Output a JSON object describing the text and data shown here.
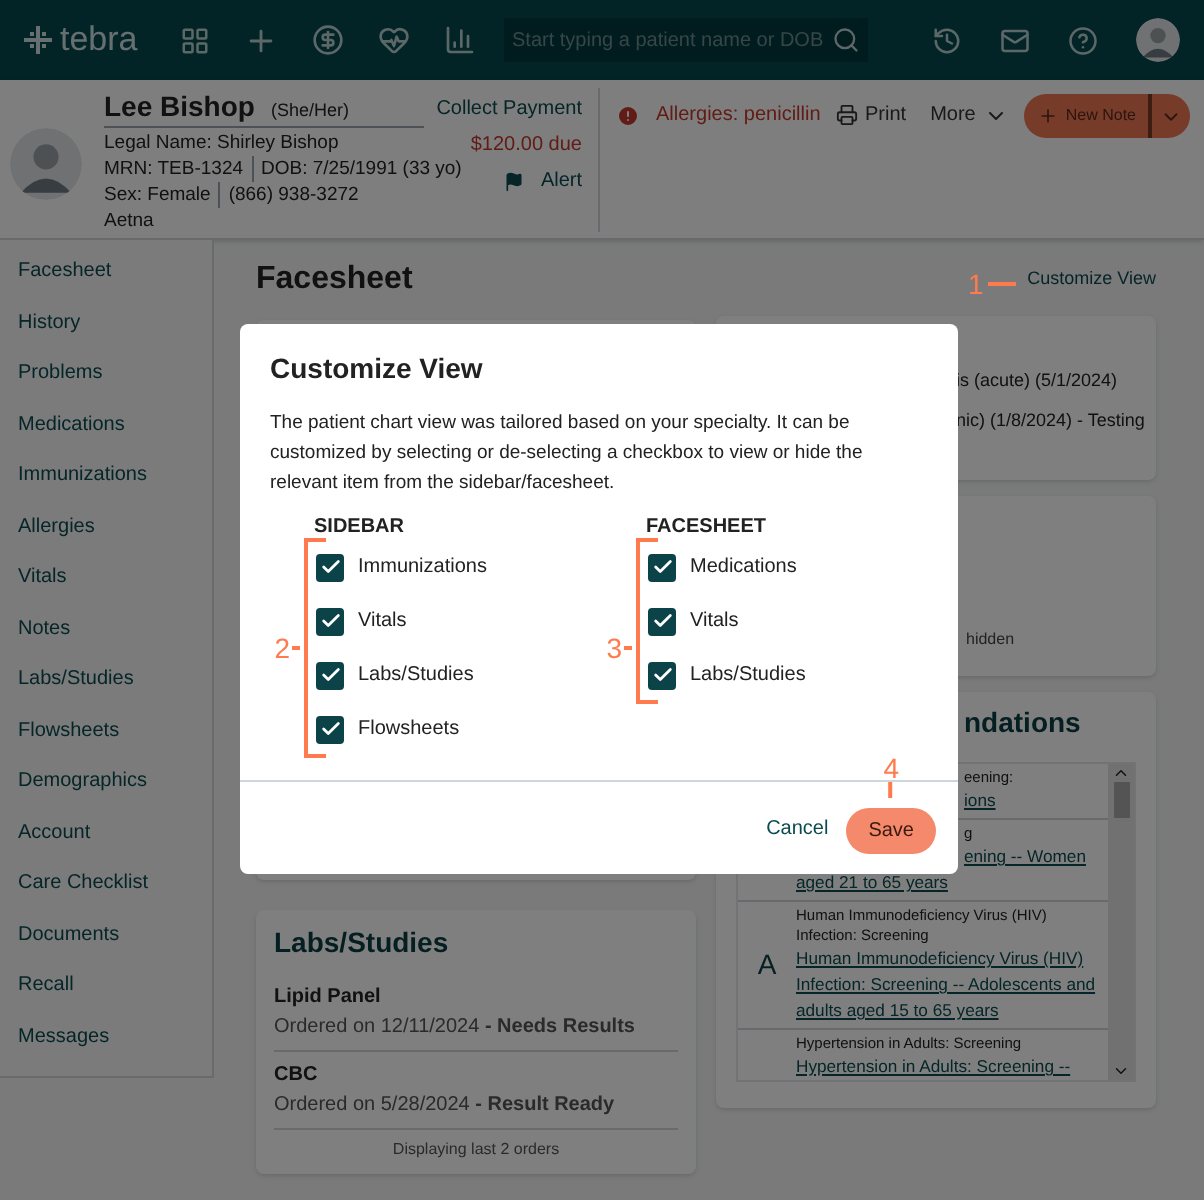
{
  "topbar": {
    "logo": "tebra",
    "search": {
      "placeholder": "Start typing a patient name or DOB"
    }
  },
  "patient": {
    "name": "Lee Bishop",
    "pronouns": "(She/Her)",
    "legal_name": "Legal Name: Shirley Bishop",
    "mrn": "MRN: TEB-1324",
    "dob": "DOB: 7/25/1991 (33 yo)",
    "sex": "Sex: Female",
    "phone": "(866) 938-3272",
    "insurance": "Aetna",
    "collect_payment": "Collect Payment",
    "amount_due": "$120.00 due",
    "alert": "Alert",
    "allergies": "Allergies: penicillin",
    "print": "Print",
    "more": "More",
    "new_note": "New Note"
  },
  "sidebar": {
    "items": [
      "Facesheet",
      "History",
      "Problems",
      "Medications",
      "Immunizations",
      "Allergies",
      "Vitals",
      "Notes",
      "Labs/Studies",
      "Flowsheets",
      "Demographics",
      "Account",
      "Care Checklist",
      "Documents",
      "Recall",
      "Messages"
    ]
  },
  "page": {
    "title": "Facesheet",
    "customize_link": "Customize View",
    "annotation": "1"
  },
  "problems_card": {
    "lines": [
      "is (acute) (5/1/2024)",
      "nic) (1/8/2024) - Testing"
    ]
  },
  "second_card": {
    "note": "hidden"
  },
  "recommendations": {
    "title": "ndations",
    "items": [
      {
        "category": "eening:",
        "link": [
          "ions"
        ],
        "covered": true
      },
      {
        "category": "g",
        "link": [
          "ening -- Women",
          "aged 21 to 65 years"
        ],
        "covered": true
      },
      {
        "grade": "A",
        "category": "Human Immunodeficiency Virus (HIV) Infection: Screening",
        "link": [
          "Human Immunodeficiency Virus (HIV) Infection: Screening -- Adolescents and adults aged 15 to 65 years"
        ],
        "covered": false
      },
      {
        "category": "Hypertension in Adults: Screening",
        "link": [
          "Hypertension in Adults: Screening --"
        ],
        "covered": false
      }
    ]
  },
  "labs": {
    "title": "Labs/Studies",
    "orders": [
      {
        "name": "Lipid Panel",
        "detail": "Ordered on 12/11/2024 **- Needs Results**"
      },
      {
        "name": "CBC",
        "detail": "Ordered on 5/28/2024 **- Result Ready**"
      }
    ],
    "footer": "Displaying last 2 orders"
  },
  "modal": {
    "title": "Customize View",
    "description": "The patient chart view was tailored based on your specialty. It can be customized by selecting or de-selecting a checkbox to view or hide the relevant item from the sidebar/facesheet.",
    "groups": [
      {
        "heading": "SIDEBAR",
        "annotation": "2",
        "items": [
          {
            "label": "Immunizations",
            "checked": true
          },
          {
            "label": "Vitals",
            "checked": true
          },
          {
            "label": "Labs/Studies",
            "checked": true
          },
          {
            "label": "Flowsheets",
            "checked": true
          }
        ]
      },
      {
        "heading": "FACESHEET",
        "annotation": "3",
        "items": [
          {
            "label": "Medications",
            "checked": true
          },
          {
            "label": "Vitals",
            "checked": true
          },
          {
            "label": "Labs/Studies",
            "checked": true
          }
        ]
      }
    ],
    "cancel": "Cancel",
    "save": "Save",
    "save_annotation": "4"
  }
}
